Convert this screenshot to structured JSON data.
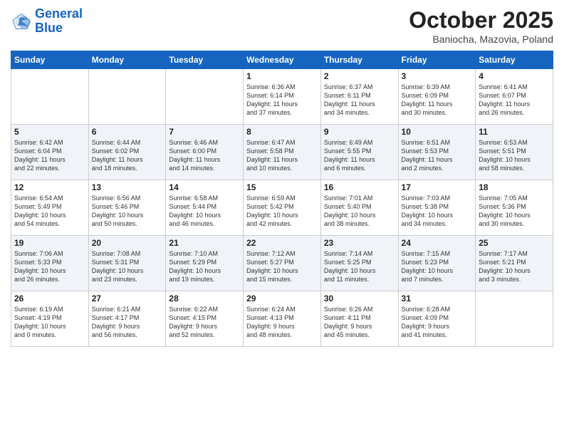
{
  "logo": {
    "line1": "General",
    "line2": "Blue"
  },
  "title": "October 2025",
  "location": "Baniocha, Mazovia, Poland",
  "weekdays": [
    "Sunday",
    "Monday",
    "Tuesday",
    "Wednesday",
    "Thursday",
    "Friday",
    "Saturday"
  ],
  "weeks": [
    [
      {
        "num": "",
        "info": ""
      },
      {
        "num": "",
        "info": ""
      },
      {
        "num": "",
        "info": ""
      },
      {
        "num": "1",
        "info": "Sunrise: 6:36 AM\nSunset: 6:14 PM\nDaylight: 11 hours\nand 37 minutes."
      },
      {
        "num": "2",
        "info": "Sunrise: 6:37 AM\nSunset: 6:11 PM\nDaylight: 11 hours\nand 34 minutes."
      },
      {
        "num": "3",
        "info": "Sunrise: 6:39 AM\nSunset: 6:09 PM\nDaylight: 11 hours\nand 30 minutes."
      },
      {
        "num": "4",
        "info": "Sunrise: 6:41 AM\nSunset: 6:07 PM\nDaylight: 11 hours\nand 26 minutes."
      }
    ],
    [
      {
        "num": "5",
        "info": "Sunrise: 6:42 AM\nSunset: 6:04 PM\nDaylight: 11 hours\nand 22 minutes."
      },
      {
        "num": "6",
        "info": "Sunrise: 6:44 AM\nSunset: 6:02 PM\nDaylight: 11 hours\nand 18 minutes."
      },
      {
        "num": "7",
        "info": "Sunrise: 6:46 AM\nSunset: 6:00 PM\nDaylight: 11 hours\nand 14 minutes."
      },
      {
        "num": "8",
        "info": "Sunrise: 6:47 AM\nSunset: 5:58 PM\nDaylight: 11 hours\nand 10 minutes."
      },
      {
        "num": "9",
        "info": "Sunrise: 6:49 AM\nSunset: 5:55 PM\nDaylight: 11 hours\nand 6 minutes."
      },
      {
        "num": "10",
        "info": "Sunrise: 6:51 AM\nSunset: 5:53 PM\nDaylight: 11 hours\nand 2 minutes."
      },
      {
        "num": "11",
        "info": "Sunrise: 6:53 AM\nSunset: 5:51 PM\nDaylight: 10 hours\nand 58 minutes."
      }
    ],
    [
      {
        "num": "12",
        "info": "Sunrise: 6:54 AM\nSunset: 5:49 PM\nDaylight: 10 hours\nand 54 minutes."
      },
      {
        "num": "13",
        "info": "Sunrise: 6:56 AM\nSunset: 5:46 PM\nDaylight: 10 hours\nand 50 minutes."
      },
      {
        "num": "14",
        "info": "Sunrise: 6:58 AM\nSunset: 5:44 PM\nDaylight: 10 hours\nand 46 minutes."
      },
      {
        "num": "15",
        "info": "Sunrise: 6:59 AM\nSunset: 5:42 PM\nDaylight: 10 hours\nand 42 minutes."
      },
      {
        "num": "16",
        "info": "Sunrise: 7:01 AM\nSunset: 5:40 PM\nDaylight: 10 hours\nand 38 minutes."
      },
      {
        "num": "17",
        "info": "Sunrise: 7:03 AM\nSunset: 5:38 PM\nDaylight: 10 hours\nand 34 minutes."
      },
      {
        "num": "18",
        "info": "Sunrise: 7:05 AM\nSunset: 5:36 PM\nDaylight: 10 hours\nand 30 minutes."
      }
    ],
    [
      {
        "num": "19",
        "info": "Sunrise: 7:06 AM\nSunset: 5:33 PM\nDaylight: 10 hours\nand 26 minutes."
      },
      {
        "num": "20",
        "info": "Sunrise: 7:08 AM\nSunset: 5:31 PM\nDaylight: 10 hours\nand 23 minutes."
      },
      {
        "num": "21",
        "info": "Sunrise: 7:10 AM\nSunset: 5:29 PM\nDaylight: 10 hours\nand 19 minutes."
      },
      {
        "num": "22",
        "info": "Sunrise: 7:12 AM\nSunset: 5:27 PM\nDaylight: 10 hours\nand 15 minutes."
      },
      {
        "num": "23",
        "info": "Sunrise: 7:14 AM\nSunset: 5:25 PM\nDaylight: 10 hours\nand 11 minutes."
      },
      {
        "num": "24",
        "info": "Sunrise: 7:15 AM\nSunset: 5:23 PM\nDaylight: 10 hours\nand 7 minutes."
      },
      {
        "num": "25",
        "info": "Sunrise: 7:17 AM\nSunset: 5:21 PM\nDaylight: 10 hours\nand 3 minutes."
      }
    ],
    [
      {
        "num": "26",
        "info": "Sunrise: 6:19 AM\nSunset: 4:19 PM\nDaylight: 10 hours\nand 0 minutes."
      },
      {
        "num": "27",
        "info": "Sunrise: 6:21 AM\nSunset: 4:17 PM\nDaylight: 9 hours\nand 56 minutes."
      },
      {
        "num": "28",
        "info": "Sunrise: 6:22 AM\nSunset: 4:15 PM\nDaylight: 9 hours\nand 52 minutes."
      },
      {
        "num": "29",
        "info": "Sunrise: 6:24 AM\nSunset: 4:13 PM\nDaylight: 9 hours\nand 48 minutes."
      },
      {
        "num": "30",
        "info": "Sunrise: 6:26 AM\nSunset: 4:11 PM\nDaylight: 9 hours\nand 45 minutes."
      },
      {
        "num": "31",
        "info": "Sunrise: 6:28 AM\nSunset: 4:09 PM\nDaylight: 9 hours\nand 41 minutes."
      },
      {
        "num": "",
        "info": ""
      }
    ]
  ]
}
